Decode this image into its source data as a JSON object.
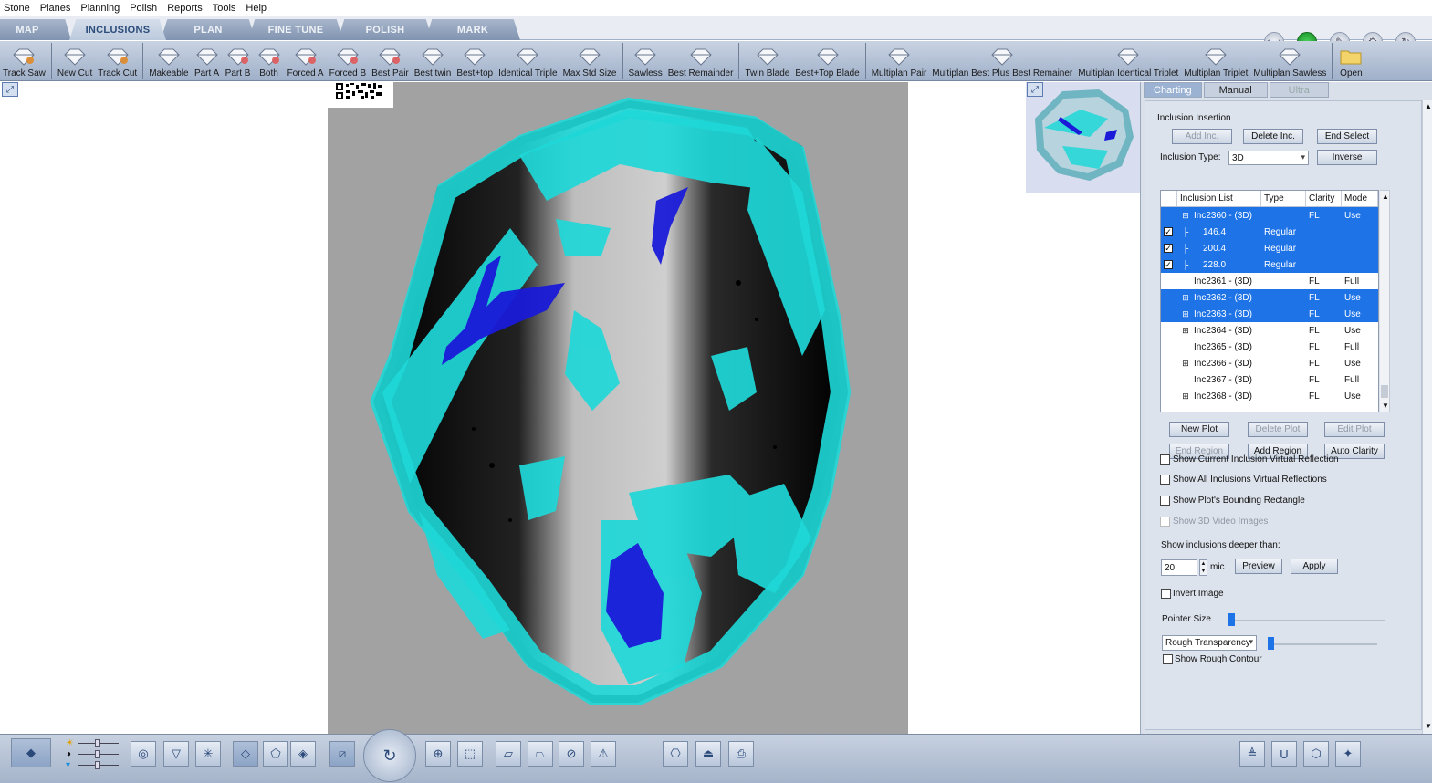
{
  "menu": [
    "Stone",
    "Planes",
    "Planning",
    "Polish",
    "Reports",
    "Tools",
    "Help"
  ],
  "tabs": [
    "MAP",
    "INCLUSIONS",
    "PLAN",
    "FINE TUNE",
    "POLISH",
    "MARK"
  ],
  "active_tab": "INCLUSIONS",
  "toolbar": [
    "Track Saw",
    "New Cut",
    "Track Cut",
    "Makeable",
    "Part A",
    "Part B",
    "Both",
    "Forced A",
    "Forced B",
    "Best Pair",
    "Best twin",
    "Best+top",
    "Identical Triple",
    "Max Std Size",
    "Sawless",
    "Best Remainder",
    "Twin Blade",
    "Best+Top Blade",
    "Multiplan Pair",
    "Multiplan Best Plus Best Remainer",
    "Multiplan Identical Triplet",
    "Multiplan Triplet",
    "Multiplan Sawless",
    "Open"
  ],
  "panel": {
    "tabs": [
      "Charting",
      "Manual",
      "Ultra"
    ],
    "section_title": "Inclusion Insertion",
    "btn_add_inc": "Add Inc.",
    "btn_delete_inc": "Delete Inc.",
    "btn_end_select": "End Select",
    "inclusion_type_label": "Inclusion Type:",
    "inclusion_type_value": "3D",
    "btn_inverse": "Inverse",
    "list_headers": [
      "Inclusion List",
      "Type",
      "Clarity",
      "Mode"
    ],
    "rows": [
      {
        "name": "Inc2360 - (3D)",
        "type": "",
        "clarity": "FL",
        "mode": "Use",
        "sel": true,
        "tree": "minus",
        "indent": 0,
        "check": false
      },
      {
        "name": "146.4",
        "type": "Regular",
        "clarity": "",
        "mode": "",
        "sel": true,
        "tree": "",
        "indent": 1,
        "check": true
      },
      {
        "name": "200.4",
        "type": "Regular",
        "clarity": "",
        "mode": "",
        "sel": true,
        "tree": "",
        "indent": 1,
        "check": true
      },
      {
        "name": "228.0",
        "type": "Regular",
        "clarity": "",
        "mode": "",
        "sel": true,
        "tree": "",
        "indent": 1,
        "check": true
      },
      {
        "name": "Inc2361 - (3D)",
        "type": "",
        "clarity": "FL",
        "mode": "Full",
        "sel": false,
        "tree": "",
        "indent": 0,
        "check": false
      },
      {
        "name": "Inc2362 - (3D)",
        "type": "",
        "clarity": "FL",
        "mode": "Use",
        "sel": true,
        "tree": "plus",
        "indent": 0,
        "check": false
      },
      {
        "name": "Inc2363 - (3D)",
        "type": "",
        "clarity": "FL",
        "mode": "Use",
        "sel": true,
        "tree": "plus",
        "indent": 0,
        "check": false
      },
      {
        "name": "Inc2364 - (3D)",
        "type": "",
        "clarity": "FL",
        "mode": "Use",
        "sel": false,
        "tree": "plus",
        "indent": 0,
        "check": false
      },
      {
        "name": "Inc2365 - (3D)",
        "type": "",
        "clarity": "FL",
        "mode": "Full",
        "sel": false,
        "tree": "",
        "indent": 0,
        "check": false
      },
      {
        "name": "Inc2366 - (3D)",
        "type": "",
        "clarity": "FL",
        "mode": "Use",
        "sel": false,
        "tree": "plus",
        "indent": 0,
        "check": false
      },
      {
        "name": "Inc2367 - (3D)",
        "type": "",
        "clarity": "FL",
        "mode": "Full",
        "sel": false,
        "tree": "",
        "indent": 0,
        "check": false
      },
      {
        "name": "Inc2368 - (3D)",
        "type": "",
        "clarity": "FL",
        "mode": "Use",
        "sel": false,
        "tree": "plus",
        "indent": 0,
        "check": false
      }
    ],
    "btn_new_plot": "New Plot",
    "btn_delete_plot": "Delete Plot",
    "btn_edit_plot": "Edit Plot",
    "btn_end_region": "End Region",
    "btn_add_region": "Add Region",
    "btn_auto_clarity": "Auto Clarity",
    "chk_current_reflection": "Show Current Inclusion Virtual Reflection",
    "chk_all_reflections": "Show All Inclusions Virtual Reflections",
    "chk_bounding_rect": "Show Plot's Bounding Rectangle",
    "chk_video_images": "Show 3D Video Images",
    "deeper_label": "Show inclusions deeper than:",
    "deeper_value": "20",
    "deeper_unit": "mic",
    "btn_preview": "Preview",
    "btn_apply": "Apply",
    "chk_invert": "Invert Image",
    "pointer_size_label": "Pointer Size",
    "pointer_size_level": 0.02,
    "rough_transparency_value": "Rough Transparency",
    "rough_transparency_level": 0.02,
    "chk_rough_contour": "Show Rough Contour"
  },
  "colors": {
    "accent": "#1e73e6",
    "inclusion_cyan": "#1fd8d8",
    "inclusion_blue": "#1a1ad8",
    "status_green": "#22b031"
  }
}
